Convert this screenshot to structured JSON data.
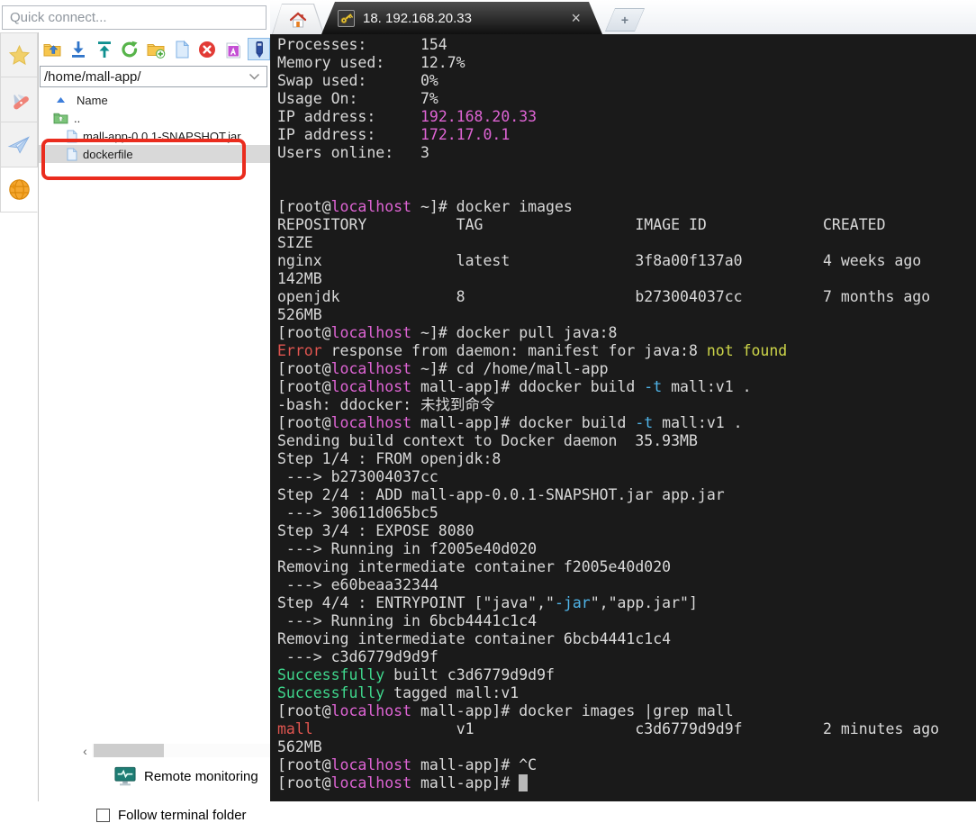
{
  "sidebar": {
    "quick_connect_placeholder": "Quick connect...",
    "nav_tabs": [
      {
        "name": "sessions",
        "icon": "star",
        "active": false
      },
      {
        "name": "tools",
        "icon": "swiss-knife",
        "active": false
      },
      {
        "name": "macros",
        "icon": "paper-plane",
        "active": false
      },
      {
        "name": "sftp",
        "icon": "globe",
        "active": true
      }
    ],
    "file_panel": {
      "toolbar_icons": [
        {
          "name": "parent-directory",
          "active": false
        },
        {
          "name": "download",
          "active": false
        },
        {
          "name": "upload",
          "active": false
        },
        {
          "name": "refresh",
          "active": false
        },
        {
          "name": "new-folder",
          "active": false
        },
        {
          "name": "new-file",
          "active": false
        },
        {
          "name": "delete",
          "active": false
        },
        {
          "name": "rename",
          "active": false
        },
        {
          "name": "edit",
          "active": true
        }
      ],
      "path": "/home/mall-app/",
      "name_header": "Name",
      "files": [
        {
          "name": "..",
          "icon": "parent-folder",
          "selected": false
        },
        {
          "name": "mall-app-0.0.1-SNAPSHOT.jar",
          "icon": "file",
          "selected": false
        },
        {
          "name": "dockerfile",
          "icon": "file",
          "selected": true,
          "annotated": true
        }
      ],
      "remote_monitoring_label": "Remote monitoring",
      "follow_terminal_label": "Follow terminal folder",
      "follow_checked": false
    }
  },
  "terminal": {
    "tabs": {
      "session_label": "18. 192.168.20.33",
      "close_glyph": "×",
      "new_tab_glyph": "+"
    },
    "palette": {
      "background": "#1a1a1a",
      "foreground": "#d9d9d9",
      "magenta": "#de64d4",
      "red": "#e05550",
      "yellow": "#cdd549",
      "cyan": "#4fb4e8",
      "green": "#3fd68c",
      "cursor": "#b9b9b9"
    },
    "lines": [
      "Processes:      154",
      "Memory used:    12.7%",
      "Swap used:      0%",
      "Usage On:       7%",
      [
        [
          "IP address:     ",
          "w"
        ],
        [
          "192.168.20.33",
          "m"
        ]
      ],
      [
        [
          "IP address:     ",
          "w"
        ],
        [
          "172.17.0.1",
          "m"
        ]
      ],
      "Users online:   3",
      "",
      "",
      [
        [
          "[root@",
          "w"
        ],
        [
          "localhost",
          "m"
        ],
        [
          " ~]# docker images",
          "w"
        ]
      ],
      "REPOSITORY          TAG                 IMAGE ID             CREATED",
      "SIZE",
      "nginx               latest              3f8a00f137a0         4 weeks ago",
      "142MB",
      "openjdk             8                   b273004037cc         7 months ago",
      "526MB",
      [
        [
          "[root@",
          "w"
        ],
        [
          "localhost",
          "m"
        ],
        [
          " ~]# docker pull java:8",
          "w"
        ]
      ],
      [
        [
          "Error",
          "r"
        ],
        [
          " response from daemon: manifest for java:8 ",
          "w"
        ],
        [
          "not found",
          "y"
        ]
      ],
      [
        [
          "[root@",
          "w"
        ],
        [
          "localhost",
          "m"
        ],
        [
          " ~]# cd /home/mall-app",
          "w"
        ]
      ],
      [
        [
          "[root@",
          "w"
        ],
        [
          "localhost",
          "m"
        ],
        [
          " mall-app]# ddocker build ",
          "w"
        ],
        [
          "-t",
          "c"
        ],
        [
          " mall:v1 .",
          "w"
        ]
      ],
      "-bash: ddocker: 未找到命令",
      [
        [
          "[root@",
          "w"
        ],
        [
          "localhost",
          "m"
        ],
        [
          " mall-app]# docker build ",
          "w"
        ],
        [
          "-t",
          "c"
        ],
        [
          " mall:v1 .",
          "w"
        ]
      ],
      "Sending build context to Docker daemon  35.93MB",
      "Step 1/4 : FROM openjdk:8",
      " ---> b273004037cc",
      "Step 2/4 : ADD mall-app-0.0.1-SNAPSHOT.jar app.jar",
      " ---> 30611d065bc5",
      "Step 3/4 : EXPOSE 8080",
      " ---> Running in f2005e40d020",
      "Removing intermediate container f2005e40d020",
      " ---> e60beaa32344",
      [
        [
          "Step 4/4 : ENTRYPOINT [\"java\",\"",
          "w"
        ],
        [
          "-jar",
          "c"
        ],
        [
          "\",\"app.jar\"]",
          "w"
        ]
      ],
      " ---> Running in 6bcb4441c1c4",
      "Removing intermediate container 6bcb4441c1c4",
      " ---> c3d6779d9d9f",
      [
        [
          "Successfully",
          "g"
        ],
        [
          " built c3d6779d9d9f",
          "w"
        ]
      ],
      [
        [
          "Successfully",
          "g"
        ],
        [
          " tagged mall:v1",
          "w"
        ]
      ],
      [
        [
          "[root@",
          "w"
        ],
        [
          "localhost",
          "m"
        ],
        [
          " mall-app]# docker images |grep mall",
          "w"
        ]
      ],
      [
        [
          "mall",
          "r"
        ],
        [
          "                v1                  c3d6779d9d9f         2 minutes ago",
          "w"
        ]
      ],
      "562MB",
      [
        [
          "[root@",
          "w"
        ],
        [
          "localhost",
          "m"
        ],
        [
          " mall-app]# ^C",
          "w"
        ]
      ],
      [
        [
          "[root@",
          "w"
        ],
        [
          "localhost",
          "m"
        ],
        [
          " mall-app]# ",
          "w"
        ],
        [
          " ",
          "cursor"
        ]
      ]
    ]
  }
}
